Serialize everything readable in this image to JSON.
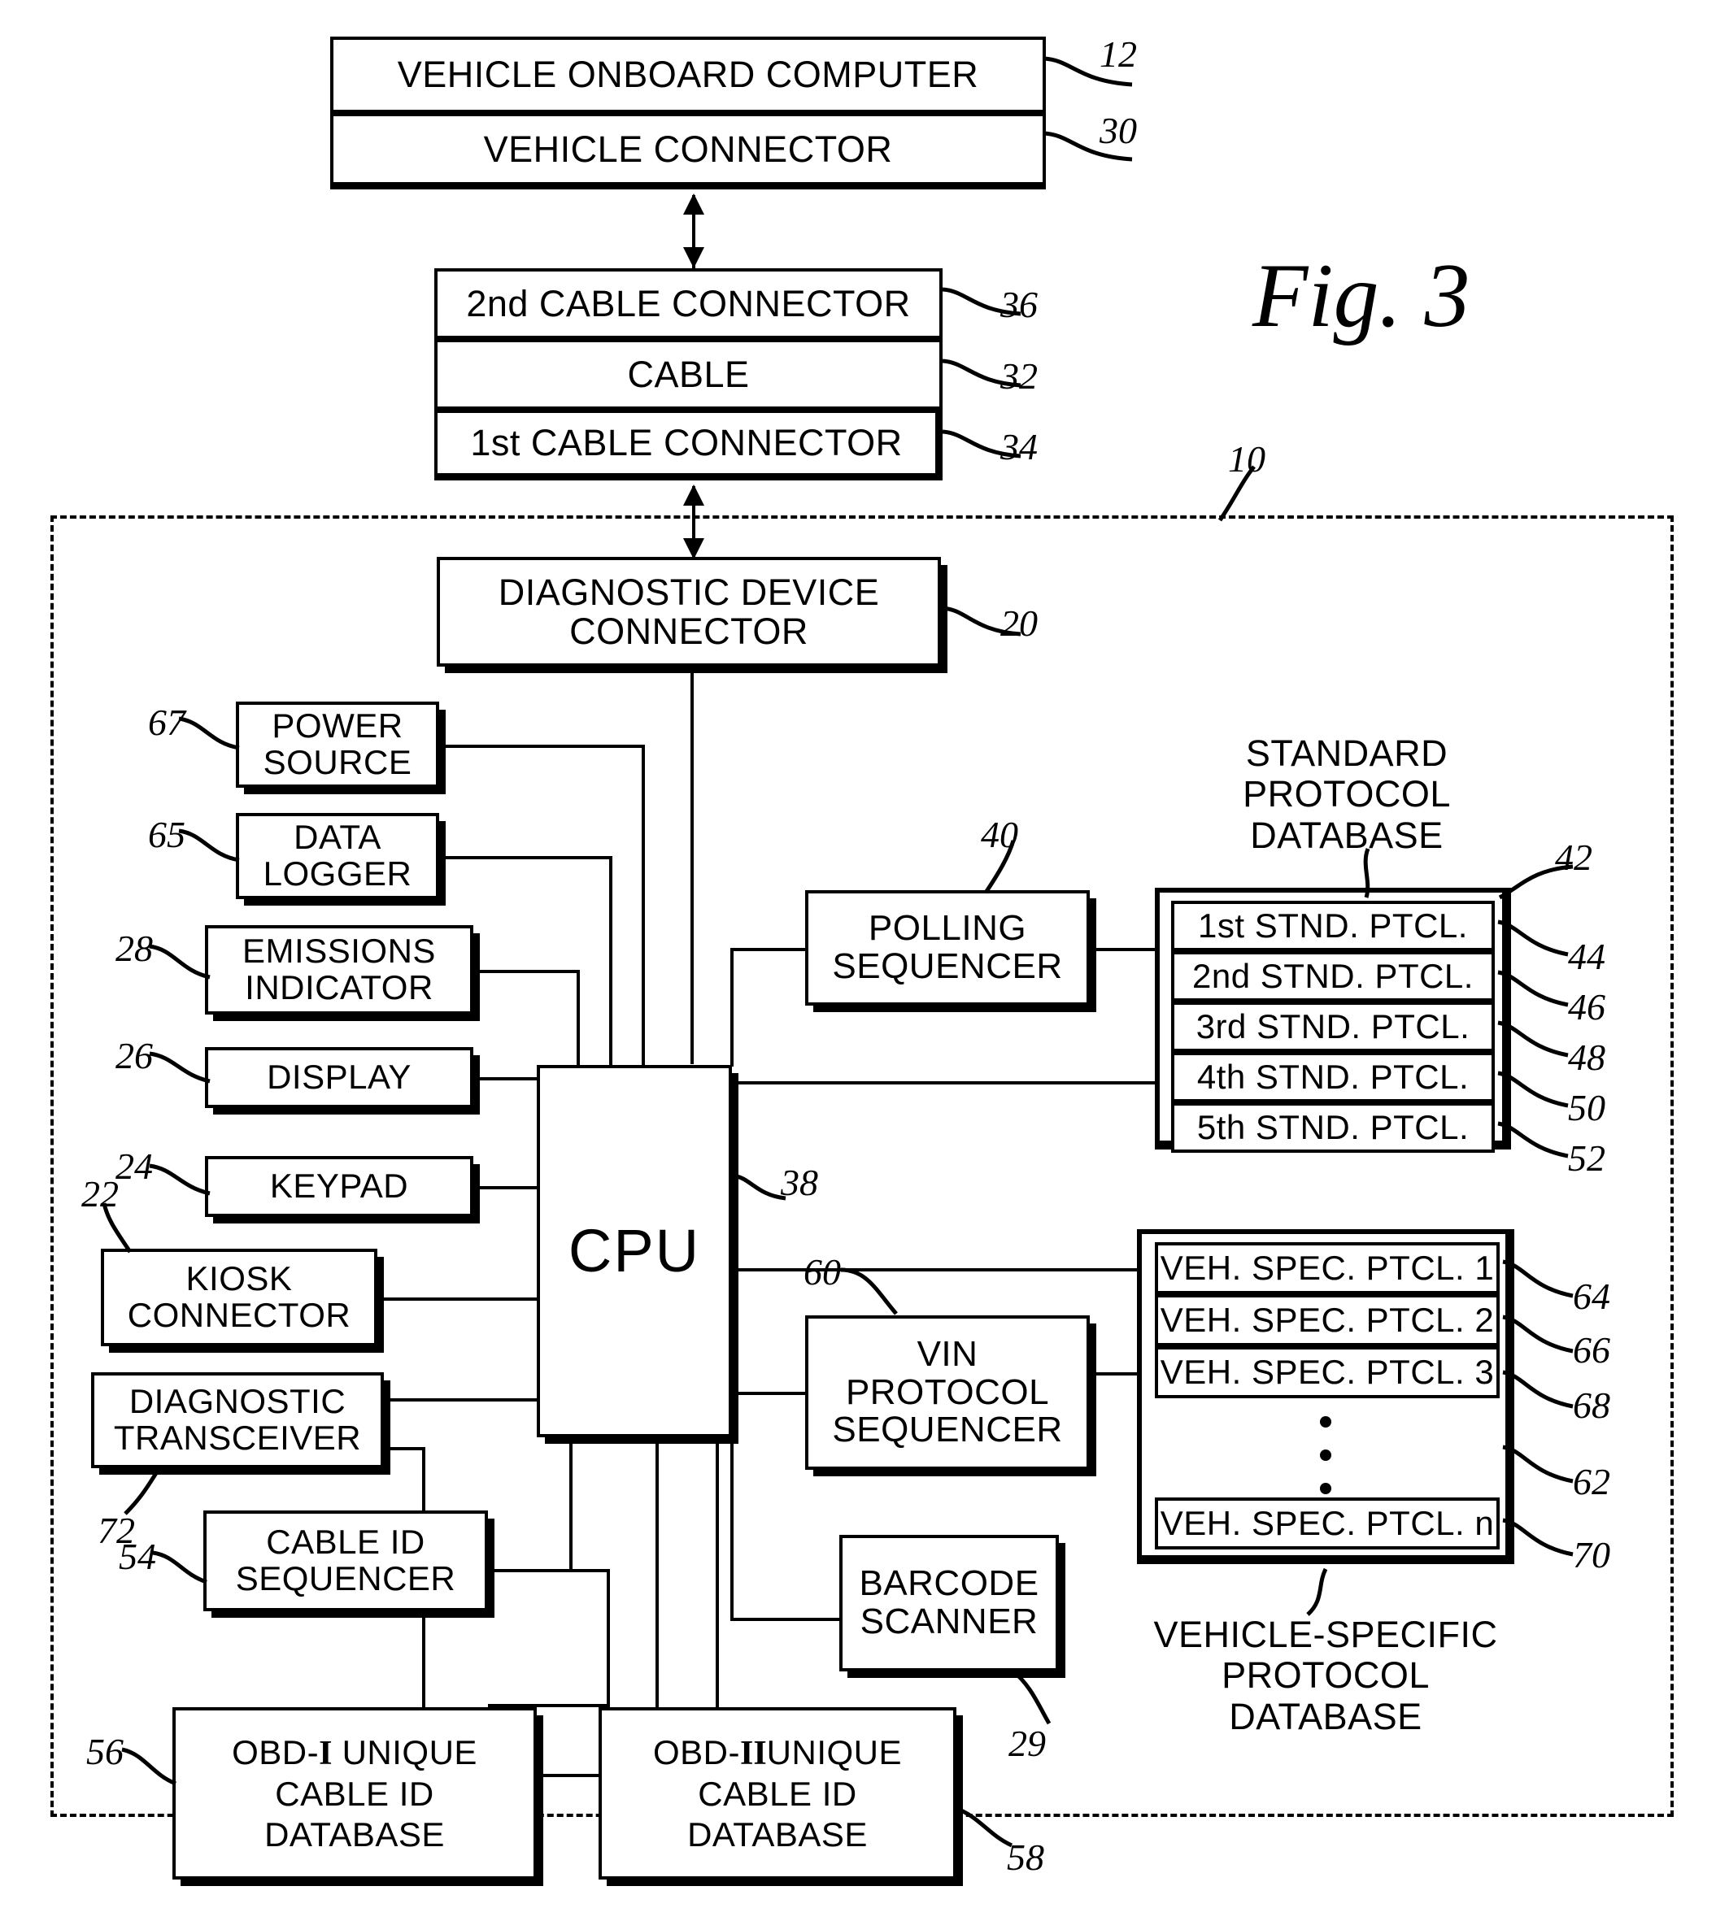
{
  "figure": {
    "label": "Fig. 3",
    "system_ref": "10"
  },
  "top_stack": {
    "items": [
      {
        "label": "VEHICLE ONBOARD COMPUTER",
        "ref": "12"
      },
      {
        "label": "VEHICLE CONNECTOR",
        "ref": "30"
      }
    ]
  },
  "cable_stack": {
    "items": [
      {
        "label": "2nd CABLE CONNECTOR",
        "ref": "36"
      },
      {
        "label": "CABLE",
        "ref": "32"
      },
      {
        "label": "1st CABLE CONNECTOR",
        "ref": "34"
      }
    ]
  },
  "device": {
    "connector": {
      "label": "DIAGNOSTIC DEVICE\nCONNECTOR",
      "ref": "20"
    },
    "cpu": {
      "label": "CPU",
      "ref": "38"
    },
    "left_column": [
      {
        "label": "POWER\nSOURCE",
        "ref": "67"
      },
      {
        "label": "DATA\nLOGGER",
        "ref": "65"
      },
      {
        "label": "EMISSIONS\nINDICATOR",
        "ref": "28"
      },
      {
        "label": "DISPLAY",
        "ref": "26"
      },
      {
        "label": "KEYPAD",
        "ref": "24"
      },
      {
        "label": "KIOSK\nCONNECTOR",
        "ref": "22"
      },
      {
        "label": "DIAGNOSTIC\nTRANSCEIVER",
        "ref": "72"
      },
      {
        "label": "CABLE ID\nSEQUENCER",
        "ref": "54"
      }
    ],
    "bottom_databases": [
      {
        "label_pre": "OBD-",
        "numeral": "I",
        "label_post": " UNIQUE\nCABLE ID\nDATABASE",
        "ref": "56"
      },
      {
        "label_pre": "OBD-",
        "numeral": "II",
        "label_post": "UNIQUE\nCABLE ID\nDATABASE",
        "ref": "58"
      }
    ],
    "sequencers": [
      {
        "label": "POLLING\nSEQUENCER",
        "ref": "40"
      },
      {
        "label": "VIN\nPROTOCOL\nSEQUENCER",
        "ref": "60"
      },
      {
        "label": "BARCODE\nSCANNER",
        "ref": "29"
      }
    ]
  },
  "standard_protocol_db": {
    "caption": "STANDARD\nPROTOCOL\nDATABASE",
    "ref": "42",
    "entries": [
      {
        "label": "1st STND. PTCL.",
        "ref": "44"
      },
      {
        "label": "2nd STND. PTCL.",
        "ref": "46"
      },
      {
        "label": "3rd STND. PTCL.",
        "ref": "48"
      },
      {
        "label": "4th STND. PTCL.",
        "ref": "50"
      },
      {
        "label": "5th STND. PTCL.",
        "ref": "52"
      }
    ]
  },
  "vehicle_specific_db": {
    "caption": "VEHICLE-SPECIFIC\nPROTOCOL DATABASE",
    "ref": "62",
    "entries": [
      {
        "label": "VEH. SPEC. PTCL. 1",
        "ref": "64"
      },
      {
        "label": "VEH. SPEC. PTCL. 2",
        "ref": "66"
      },
      {
        "label": "VEH. SPEC. PTCL. 3",
        "ref": "68"
      },
      {
        "label": "VEH. SPEC. PTCL. n",
        "ref": "70"
      }
    ],
    "ellipsis": "⋮"
  }
}
